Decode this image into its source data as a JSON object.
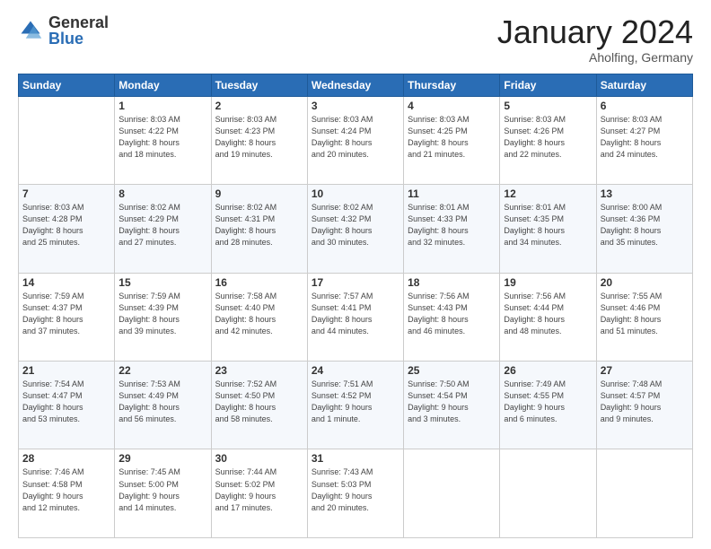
{
  "logo": {
    "general": "General",
    "blue": "Blue"
  },
  "title": "January 2024",
  "location": "Aholfing, Germany",
  "days_header": [
    "Sunday",
    "Monday",
    "Tuesday",
    "Wednesday",
    "Thursday",
    "Friday",
    "Saturday"
  ],
  "weeks": [
    [
      {
        "num": "",
        "info": ""
      },
      {
        "num": "1",
        "info": "Sunrise: 8:03 AM\nSunset: 4:22 PM\nDaylight: 8 hours\nand 18 minutes."
      },
      {
        "num": "2",
        "info": "Sunrise: 8:03 AM\nSunset: 4:23 PM\nDaylight: 8 hours\nand 19 minutes."
      },
      {
        "num": "3",
        "info": "Sunrise: 8:03 AM\nSunset: 4:24 PM\nDaylight: 8 hours\nand 20 minutes."
      },
      {
        "num": "4",
        "info": "Sunrise: 8:03 AM\nSunset: 4:25 PM\nDaylight: 8 hours\nand 21 minutes."
      },
      {
        "num": "5",
        "info": "Sunrise: 8:03 AM\nSunset: 4:26 PM\nDaylight: 8 hours\nand 22 minutes."
      },
      {
        "num": "6",
        "info": "Sunrise: 8:03 AM\nSunset: 4:27 PM\nDaylight: 8 hours\nand 24 minutes."
      }
    ],
    [
      {
        "num": "7",
        "info": "Sunrise: 8:03 AM\nSunset: 4:28 PM\nDaylight: 8 hours\nand 25 minutes."
      },
      {
        "num": "8",
        "info": "Sunrise: 8:02 AM\nSunset: 4:29 PM\nDaylight: 8 hours\nand 27 minutes."
      },
      {
        "num": "9",
        "info": "Sunrise: 8:02 AM\nSunset: 4:31 PM\nDaylight: 8 hours\nand 28 minutes."
      },
      {
        "num": "10",
        "info": "Sunrise: 8:02 AM\nSunset: 4:32 PM\nDaylight: 8 hours\nand 30 minutes."
      },
      {
        "num": "11",
        "info": "Sunrise: 8:01 AM\nSunset: 4:33 PM\nDaylight: 8 hours\nand 32 minutes."
      },
      {
        "num": "12",
        "info": "Sunrise: 8:01 AM\nSunset: 4:35 PM\nDaylight: 8 hours\nand 34 minutes."
      },
      {
        "num": "13",
        "info": "Sunrise: 8:00 AM\nSunset: 4:36 PM\nDaylight: 8 hours\nand 35 minutes."
      }
    ],
    [
      {
        "num": "14",
        "info": "Sunrise: 7:59 AM\nSunset: 4:37 PM\nDaylight: 8 hours\nand 37 minutes."
      },
      {
        "num": "15",
        "info": "Sunrise: 7:59 AM\nSunset: 4:39 PM\nDaylight: 8 hours\nand 39 minutes."
      },
      {
        "num": "16",
        "info": "Sunrise: 7:58 AM\nSunset: 4:40 PM\nDaylight: 8 hours\nand 42 minutes."
      },
      {
        "num": "17",
        "info": "Sunrise: 7:57 AM\nSunset: 4:41 PM\nDaylight: 8 hours\nand 44 minutes."
      },
      {
        "num": "18",
        "info": "Sunrise: 7:56 AM\nSunset: 4:43 PM\nDaylight: 8 hours\nand 46 minutes."
      },
      {
        "num": "19",
        "info": "Sunrise: 7:56 AM\nSunset: 4:44 PM\nDaylight: 8 hours\nand 48 minutes."
      },
      {
        "num": "20",
        "info": "Sunrise: 7:55 AM\nSunset: 4:46 PM\nDaylight: 8 hours\nand 51 minutes."
      }
    ],
    [
      {
        "num": "21",
        "info": "Sunrise: 7:54 AM\nSunset: 4:47 PM\nDaylight: 8 hours\nand 53 minutes."
      },
      {
        "num": "22",
        "info": "Sunrise: 7:53 AM\nSunset: 4:49 PM\nDaylight: 8 hours\nand 56 minutes."
      },
      {
        "num": "23",
        "info": "Sunrise: 7:52 AM\nSunset: 4:50 PM\nDaylight: 8 hours\nand 58 minutes."
      },
      {
        "num": "24",
        "info": "Sunrise: 7:51 AM\nSunset: 4:52 PM\nDaylight: 9 hours\nand 1 minute."
      },
      {
        "num": "25",
        "info": "Sunrise: 7:50 AM\nSunset: 4:54 PM\nDaylight: 9 hours\nand 3 minutes."
      },
      {
        "num": "26",
        "info": "Sunrise: 7:49 AM\nSunset: 4:55 PM\nDaylight: 9 hours\nand 6 minutes."
      },
      {
        "num": "27",
        "info": "Sunrise: 7:48 AM\nSunset: 4:57 PM\nDaylight: 9 hours\nand 9 minutes."
      }
    ],
    [
      {
        "num": "28",
        "info": "Sunrise: 7:46 AM\nSunset: 4:58 PM\nDaylight: 9 hours\nand 12 minutes."
      },
      {
        "num": "29",
        "info": "Sunrise: 7:45 AM\nSunset: 5:00 PM\nDaylight: 9 hours\nand 14 minutes."
      },
      {
        "num": "30",
        "info": "Sunrise: 7:44 AM\nSunset: 5:02 PM\nDaylight: 9 hours\nand 17 minutes."
      },
      {
        "num": "31",
        "info": "Sunrise: 7:43 AM\nSunset: 5:03 PM\nDaylight: 9 hours\nand 20 minutes."
      },
      {
        "num": "",
        "info": ""
      },
      {
        "num": "",
        "info": ""
      },
      {
        "num": "",
        "info": ""
      }
    ]
  ]
}
